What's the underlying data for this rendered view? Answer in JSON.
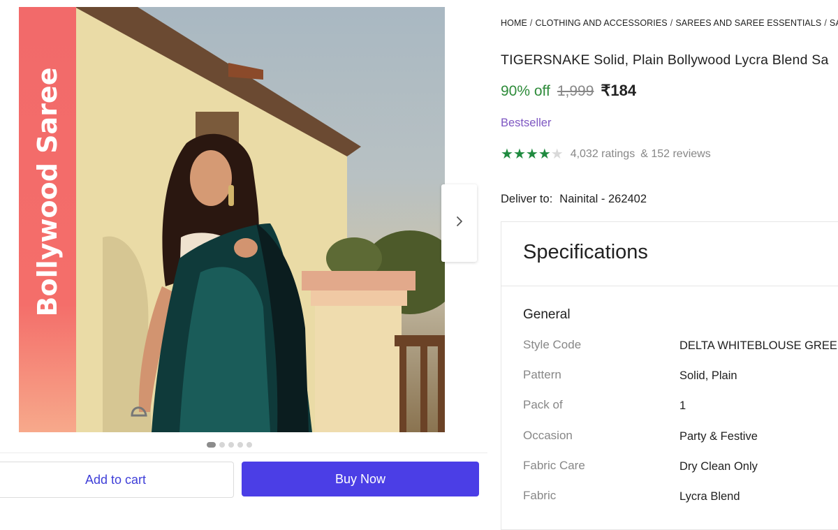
{
  "gallery": {
    "banner_text": "Bollywood Saree",
    "next_icon": "chevron-right-icon",
    "dots_count": 5,
    "active_dot": 0
  },
  "actions": {
    "add_to_cart": "Add to cart",
    "buy_now": "Buy Now"
  },
  "breadcrumb": [
    "HOME",
    "CLOTHING AND ACCESSORIES",
    "SAREES AND SAREE ESSENTIALS",
    "SAR"
  ],
  "product": {
    "title": "TIGERSNAKE Solid, Plain Bollywood Lycra Blend Sa",
    "discount": "90% off",
    "mrp": "1,999",
    "price": "₹184",
    "badge": "Bestseller",
    "rating_stars": 4,
    "ratings_count": "4,032 ratings",
    "reviews_count": "& 152 reviews"
  },
  "delivery": {
    "label": "Deliver to:",
    "location": "Nainital - 262402"
  },
  "specifications": {
    "title": "Specifications",
    "section": "General",
    "rows": [
      {
        "label": "Style Code",
        "value": "DELTA WHITEBLOUSE GREEN_"
      },
      {
        "label": "Pattern",
        "value": "Solid, Plain"
      },
      {
        "label": "Pack of",
        "value": "1"
      },
      {
        "label": "Occasion",
        "value": "Party & Festive"
      },
      {
        "label": "Fabric Care",
        "value": "Dry Clean Only"
      },
      {
        "label": "Fabric",
        "value": "Lycra Blend"
      }
    ]
  },
  "colors": {
    "accent": "#4b3ee6",
    "discount": "#2e8b3a",
    "bestseller": "#7e57c2",
    "star": "#1f8a3f",
    "banner": "#f26a6a"
  }
}
